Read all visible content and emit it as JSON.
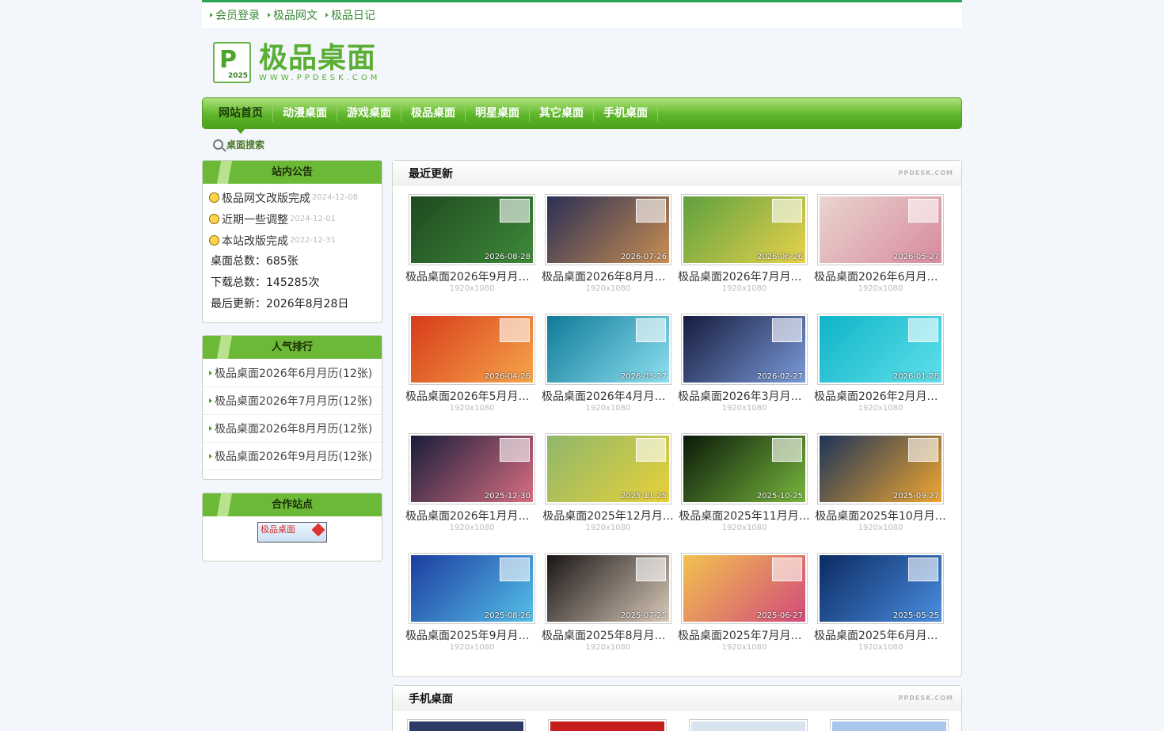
{
  "topbar": {
    "links": [
      "会员登录",
      "极品网文",
      "极品日记"
    ]
  },
  "logo": {
    "mark_letter": "P",
    "mark_year": "2025",
    "title": "极品桌面",
    "domain": "WWW.PPDESK.COM"
  },
  "nav": {
    "items": [
      "网站首页",
      "动漫桌面",
      "游戏桌面",
      "极品桌面",
      "明星桌面",
      "其它桌面",
      "手机桌面"
    ],
    "active": "网站首页"
  },
  "search": {
    "label": "桌面搜索"
  },
  "sidebar": {
    "notice": {
      "title": "站内公告",
      "items": [
        {
          "text": "极品网文改版完成",
          "date": "2024-12-08"
        },
        {
          "text": "近期一些调整",
          "date": "2024-12-01"
        },
        {
          "text": "本站改版完成",
          "date": "2022-12-31"
        }
      ],
      "stats": [
        "桌面总数：685张",
        "下载总数：145285次",
        "最后更新：2026年8月28日"
      ]
    },
    "rank": {
      "title": "人气排行",
      "items": [
        "极品桌面2026年6月月历(12张)",
        "极品桌面2026年7月月历(12张)",
        "极品桌面2026年8月月历(12张)",
        "极品桌面2026年9月月历(12张)"
      ]
    },
    "partners": {
      "title": "合作站点",
      "badge": "极品桌面"
    }
  },
  "recent": {
    "title": "最近更新",
    "brand": "PPDESK.COM",
    "items": [
      {
        "title": "极品桌面2026年9月月历…",
        "date": "2026-08-28",
        "size": "1920x1080",
        "color1": "#1e4a20",
        "color2": "#3f8a3a"
      },
      {
        "title": "极品桌面2026年8月月历…",
        "date": "2026-07-26",
        "size": "1920x1080",
        "color1": "#2a2f55",
        "color2": "#c98e52"
      },
      {
        "title": "极品桌面2026年7月月历…",
        "date": "2026-06-26",
        "size": "1920x1080",
        "color1": "#5fa040",
        "color2": "#e7d24a"
      },
      {
        "title": "极品桌面2026年6月月历…",
        "date": "2026-05-27",
        "size": "1920x1080",
        "color1": "#e9d5cf",
        "color2": "#d88a9d"
      },
      {
        "title": "极品桌面2026年5月月历…",
        "date": "2026-04-26",
        "size": "1920x1080",
        "color1": "#d73b1a",
        "color2": "#f6a64a"
      },
      {
        "title": "极品桌面2026年4月月历…",
        "date": "2026-03-27",
        "size": "1920x1080",
        "color1": "#0f7a98",
        "color2": "#8ee0f0"
      },
      {
        "title": "极品桌面2026年3月月历…",
        "date": "2026-02-27",
        "size": "1920x1080",
        "color1": "#161c3f",
        "color2": "#7b9ad8"
      },
      {
        "title": "极品桌面2026年2月月历…",
        "date": "2026-01-28",
        "size": "1920x1080",
        "color1": "#0fb4c8",
        "color2": "#5fe0ea"
      },
      {
        "title": "极品桌面2026年1月月历…",
        "date": "2025-12-30",
        "size": "1920x1080",
        "color1": "#1a1d3a",
        "color2": "#d86f82"
      },
      {
        "title": "极品桌面2025年12月月…",
        "date": "2025-11-25",
        "size": "1920x1080",
        "color1": "#8fb76b",
        "color2": "#e8d13a"
      },
      {
        "title": "极品桌面2025年11月月…",
        "date": "2025-10-25",
        "size": "1920x1080",
        "color1": "#0a1a0a",
        "color2": "#78b63c"
      },
      {
        "title": "极品桌面2025年10月月…",
        "date": "2025-09-27",
        "size": "1920x1080",
        "color1": "#1d3458",
        "color2": "#f0a730"
      },
      {
        "title": "极品桌面2025年9月月历…",
        "date": "2025-08-26",
        "size": "1920x1080",
        "color1": "#1d3da0",
        "color2": "#55c0e8"
      },
      {
        "title": "极品桌面2025年8月月历…",
        "date": "2025-07-25",
        "size": "1920x1080",
        "color1": "#1a1616",
        "color2": "#d8c8b8"
      },
      {
        "title": "极品桌面2025年7月月历…",
        "date": "2025-06-27",
        "size": "1920x1080",
        "color1": "#f2c24f",
        "color2": "#d24a7a"
      },
      {
        "title": "极品桌面2025年6月月历…",
        "date": "2025-05-25",
        "size": "1920x1080",
        "color1": "#0b2a63",
        "color2": "#4a8ee0"
      }
    ]
  },
  "mobile": {
    "title": "手机桌面",
    "brand": "PPDESK.COM",
    "thumbs": [
      "#2d3a66",
      "#c51c1c",
      "#d7e3ee",
      "#a9c7ec"
    ]
  },
  "colors": {
    "accent": "#4aa21d",
    "link": "#3a8a3a"
  }
}
